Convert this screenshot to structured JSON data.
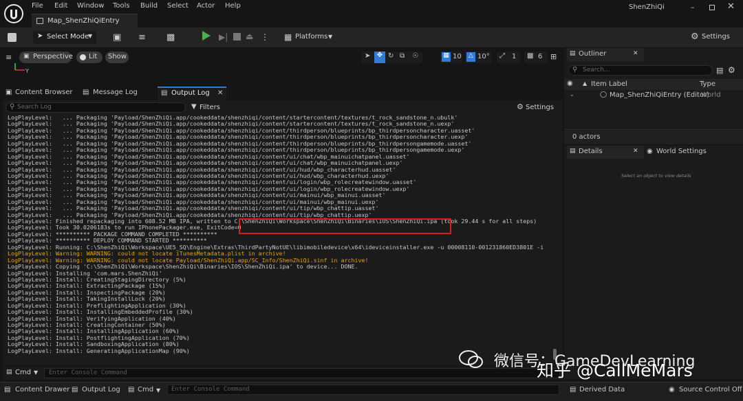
{
  "app": {
    "title": "ShenZhiQi",
    "map_tab": "Map_ShenZhiQiEntry"
  },
  "menu": [
    "File",
    "Edit",
    "Window",
    "Tools",
    "Build",
    "Select",
    "Actor",
    "Help"
  ],
  "toolbar": {
    "select_mode": "Select Mode",
    "platforms": "Platforms",
    "settings": "Settings"
  },
  "viewport": {
    "perspective": "Perspective",
    "lit": "Lit",
    "show": "Show",
    "grid_snap": "10",
    "rot_snap": "10°",
    "scale_snap": "1",
    "cam_speed": "6"
  },
  "log_tabs": [
    "Content Browser",
    "Message Log",
    "Output Log"
  ],
  "log": {
    "search_placeholder": "Search Log",
    "filters": "Filters",
    "settings": "Settings",
    "lines": [
      {
        "t": "LogPlayLevel:   ... Packaging 'Payload/ShenZhiQi.app/cookeddata/shenzhiqi/content/startercontent/textures/t_rock_sandstone_n.ubulk'",
        "w": false
      },
      {
        "t": "LogPlayLevel:   ... Packaging 'Payload/ShenZhiQi.app/cookeddata/shenzhiqi/content/startercontent/textures/t_rock_sandstone_n.uexp'",
        "w": false
      },
      {
        "t": "LogPlayLevel:   ... Packaging 'Payload/ShenZhiQi.app/cookeddata/shenzhiqi/content/thirdperson/blueprints/bp_thirdpersoncharacter.uasset'",
        "w": false
      },
      {
        "t": "LogPlayLevel:   ... Packaging 'Payload/ShenZhiQi.app/cookeddata/shenzhiqi/content/thirdperson/blueprints/bp_thirdpersoncharacter.uexp'",
        "w": false
      },
      {
        "t": "LogPlayLevel:   ... Packaging 'Payload/ShenZhiQi.app/cookeddata/shenzhiqi/content/thirdperson/blueprints/bp_thirdpersongamemode.uasset'",
        "w": false
      },
      {
        "t": "LogPlayLevel:   ... Packaging 'Payload/ShenZhiQi.app/cookeddata/shenzhiqi/content/thirdperson/blueprints/bp_thirdpersongamemode.uexp'",
        "w": false
      },
      {
        "t": "LogPlayLevel:   ... Packaging 'Payload/ShenZhiQi.app/cookeddata/shenzhiqi/content/ui/chat/wbp_mainuichatpanel.uasset'",
        "w": false
      },
      {
        "t": "LogPlayLevel:   ... Packaging 'Payload/ShenZhiQi.app/cookeddata/shenzhiqi/content/ui/chat/wbp_mainuichatpanel.uexp'",
        "w": false
      },
      {
        "t": "LogPlayLevel:   ... Packaging 'Payload/ShenZhiQi.app/cookeddata/shenzhiqi/content/ui/hud/wbp_characterhud.uasset'",
        "w": false
      },
      {
        "t": "LogPlayLevel:   ... Packaging 'Payload/ShenZhiQi.app/cookeddata/shenzhiqi/content/ui/hud/wbp_characterhud.uexp'",
        "w": false
      },
      {
        "t": "LogPlayLevel:   ... Packaging 'Payload/ShenZhiQi.app/cookeddata/shenzhiqi/content/ui/login/wbp_rolecreatewindow.uasset'",
        "w": false
      },
      {
        "t": "LogPlayLevel:   ... Packaging 'Payload/ShenZhiQi.app/cookeddata/shenzhiqi/content/ui/login/wbp_rolecreatewindow.uexp'",
        "w": false
      },
      {
        "t": "LogPlayLevel:   ... Packaging 'Payload/ShenZhiQi.app/cookeddata/shenzhiqi/content/ui/mainui/wbp_mainui.uasset'",
        "w": false
      },
      {
        "t": "LogPlayLevel:   ... Packaging 'Payload/ShenZhiQi.app/cookeddata/shenzhiqi/content/ui/mainui/wbp_mainui.uexp'",
        "w": false
      },
      {
        "t": "LogPlayLevel:   ... Packaging 'Payload/ShenZhiQi.app/cookeddata/shenzhiqi/content/ui/tip/wbp_chattip.uasset'",
        "w": false
      },
      {
        "t": "LogPlayLevel:   ... Packaging 'Payload/ShenZhiQi.app/cookeddata/shenzhiqi/content/ui/tip/wbp_chattip.uexp'",
        "w": false
      },
      {
        "t": "LogPlayLevel: Finished repackaging into 608.52 MB IPA, written to C:\\ShenZhiQi\\Workspace\\ShenZhiQi\\Binaries\\IOS\\ShenZhiQi.ipa (took 29.44 s for all steps)",
        "w": false
      },
      {
        "t": "LogPlayLevel: Took 30.0206183s to run IPhonePackager.exe, ExitCode=0",
        "w": false
      },
      {
        "t": "LogPlayLevel: ********** PACKAGE COMMAND COMPLETED **********",
        "w": false
      },
      {
        "t": "LogPlayLevel: ********** DEPLOY COMMAND STARTED **********",
        "w": false
      },
      {
        "t": "LogPlayLevel: Running: C:\\ShenZhiQi\\Workspace\\UE5_SQ\\Engine\\Extras\\ThirdPartyNotUE\\libimobiledevice\\x64\\ideviceinstaller.exe -u 00008110-001231860ED3801E -i",
        "w": false
      },
      {
        "t": "LogPlayLevel: Warning: WARNING: could not locate iTunesMetadata.plist in archive!",
        "w": true
      },
      {
        "t": "LogPlayLevel: Warning: WARNING: could not locate Payload/ShenZhiQi.app/SC_Info/ShenZhiQi.sinf in archive!",
        "w": true
      },
      {
        "t": "LogPlayLevel: Copying 'C:\\ShenZhiQi\\Workspace\\ShenZhiQi\\Binaries\\IOS\\ShenZhiQi.ipa' to device... DONE.",
        "w": false
      },
      {
        "t": "LogPlayLevel: Installing 'com.mars.ShenZhiQi'",
        "w": false
      },
      {
        "t": "LogPlayLevel: Install: CreatingStagingDirectory (5%)",
        "w": false
      },
      {
        "t": "LogPlayLevel: Install: ExtractingPackage (15%)",
        "w": false
      },
      {
        "t": "LogPlayLevel: Install: InspectingPackage (20%)",
        "w": false
      },
      {
        "t": "LogPlayLevel: Install: TakingInstallLock (20%)",
        "w": false
      },
      {
        "t": "LogPlayLevel: Install: PreflightingApplication (30%)",
        "w": false
      },
      {
        "t": "LogPlayLevel: Install: InstallingEmbeddedProfile (30%)",
        "w": false
      },
      {
        "t": "LogPlayLevel: Install: VerifyingApplication (40%)",
        "w": false
      },
      {
        "t": "LogPlayLevel: Install: CreatingContainer (50%)",
        "w": false
      },
      {
        "t": "LogPlayLevel: Install: InstallingApplication (60%)",
        "w": false
      },
      {
        "t": "LogPlayLevel: Install: PostflightingApplication (70%)",
        "w": false
      },
      {
        "t": "LogPlayLevel: Install: SandboxingApplication (80%)",
        "w": false
      },
      {
        "t": "LogPlayLevel: Install: GeneratingApplicationMap (90%)",
        "w": false
      }
    ]
  },
  "cmd": {
    "label": "Cmd",
    "placeholder": "Enter Console Command"
  },
  "outliner": {
    "tab": "Outliner",
    "search_placeholder": "Search...",
    "col_label": "Item Label",
    "col_type": "Type",
    "row_label": "Map_ShenZhiQiEntry (Editor)",
    "row_type": "World",
    "actors": "0 actors"
  },
  "details": {
    "tab": "Details",
    "world_tab": "World Settings",
    "hint": "Select an object to view details"
  },
  "statusbar": {
    "content_drawer": "Content Drawer",
    "output_log": "Output Log",
    "cmd": "Cmd",
    "cmd_placeholder": "Enter Console Command",
    "derived_data": "Derived Data",
    "source_control": "Source Control Off"
  },
  "watermark": "知乎 @CallMeMars",
  "watermark2": "微信号：GameDevLearning",
  "colors": {
    "warning": "#e5a50a",
    "highlight_box": "#e01b1b",
    "accent_green": "#4caf50",
    "accent_blue": "#2f7bd6"
  }
}
